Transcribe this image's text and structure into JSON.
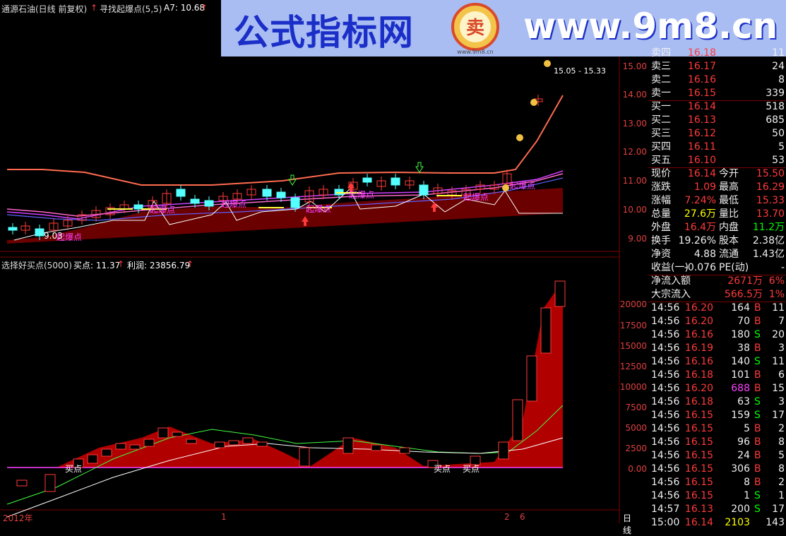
{
  "header": {
    "stock": "通源石油(日线 前复权)",
    "indicator_name": "寻找起爆点(5,5)",
    "a7_label": "A7: 10.68",
    "sub_indicator": "选择好买点(5000)",
    "buy_label": "买点: 11.37",
    "profit_label": "利润: 23856.79"
  },
  "watermark": {
    "cn": "公式指标网",
    "en": "www.9m8.cn",
    "logo_text": "卖",
    "logo_sub": "www.9m8.cn"
  },
  "price_range_label": "15.05 - 15.33",
  "price_axis": [
    "15.00",
    "14.00",
    "13.00",
    "12.00",
    "11.00",
    "10.00",
    "9.00"
  ],
  "volume_axis": [
    "20000",
    "17500",
    "15000",
    "12500",
    "10000",
    "7500",
    "5000",
    "2500",
    "0.00"
  ],
  "x_axis": {
    "year": "2012年",
    "m1": "1",
    "m2": "2",
    "m3": "6"
  },
  "period_label": "日线",
  "chart_annotations": {
    "bao": "起爆点",
    "bao_small": "起爆点",
    "buy": "买点",
    "low_price": "9.03"
  },
  "quote": {
    "asks": [
      {
        "label": "卖四",
        "price": "16.18",
        "vol": "11"
      },
      {
        "label": "卖三",
        "price": "16.17",
        "vol": "24"
      },
      {
        "label": "卖二",
        "price": "16.16",
        "vol": "8"
      },
      {
        "label": "卖一",
        "price": "16.15",
        "vol": "339"
      }
    ],
    "bids": [
      {
        "label": "买一",
        "price": "16.14",
        "vol": "518"
      },
      {
        "label": "买二",
        "price": "16.13",
        "vol": "685"
      },
      {
        "label": "买三",
        "price": "16.12",
        "vol": "50"
      },
      {
        "label": "买四",
        "price": "16.11",
        "vol": "5"
      },
      {
        "label": "买五",
        "price": "16.10",
        "vol": "53"
      }
    ],
    "stats": [
      {
        "k1": "现价",
        "v1": "16.14",
        "c1": "red",
        "k2": "今开",
        "v2": "15.50",
        "c2": "red"
      },
      {
        "k1": "涨跌",
        "v1": "1.09",
        "c1": "red",
        "k2": "最高",
        "v2": "16.29",
        "c2": "red"
      },
      {
        "k1": "涨幅",
        "v1": "7.24%",
        "c1": "red",
        "k2": "最低",
        "v2": "15.33",
        "c2": "red"
      },
      {
        "k1": "总量",
        "v1": "27.6万",
        "c1": "yel",
        "k2": "量比",
        "v2": "13.70",
        "c2": "red"
      },
      {
        "k1": "外盘",
        "v1": "16.4万",
        "c1": "red",
        "k2": "内盘",
        "v2": "11.2万",
        "c2": "grn"
      },
      {
        "k1": "换手",
        "v1": "19.26%",
        "c1": "wht",
        "k2": "股本",
        "v2": "2.38亿",
        "c2": "wht"
      },
      {
        "k1": "净资",
        "v1": "4.88",
        "c1": "wht",
        "k2": "流通",
        "v2": "1.43亿",
        "c2": "wht"
      },
      {
        "k1": "收益(一)",
        "v1": "-0.076",
        "c1": "wht",
        "k2": "PE(动)",
        "v2": "-",
        "c2": "wht"
      }
    ],
    "net_inflow": {
      "label": "净流入额",
      "value": "2671万",
      "pct": "6%"
    },
    "block_inflow": {
      "label": "大宗流入",
      "value": "566.5万",
      "pct": "1%"
    },
    "ticks": [
      {
        "t": "14:56",
        "p": "16.20",
        "v": "164",
        "s": "B",
        "n": "11"
      },
      {
        "t": "14:56",
        "p": "16.20",
        "v": "70",
        "s": "B",
        "n": "7"
      },
      {
        "t": "14:56",
        "p": "16.16",
        "v": "180",
        "s": "S",
        "n": "20"
      },
      {
        "t": "14:56",
        "p": "16.19",
        "v": "38",
        "s": "B",
        "n": "3"
      },
      {
        "t": "14:56",
        "p": "16.16",
        "v": "140",
        "s": "S",
        "n": "11"
      },
      {
        "t": "14:56",
        "p": "16.18",
        "v": "101",
        "s": "B",
        "n": "6"
      },
      {
        "t": "14:56",
        "p": "16.20",
        "v": "688",
        "s": "B",
        "n": "15"
      },
      {
        "t": "14:56",
        "p": "16.18",
        "v": "63",
        "s": "S",
        "n": "3"
      },
      {
        "t": "14:56",
        "p": "16.15",
        "v": "159",
        "s": "S",
        "n": "17"
      },
      {
        "t": "14:56",
        "p": "16.15",
        "v": "5",
        "s": "B",
        "n": "2"
      },
      {
        "t": "14:56",
        "p": "16.15",
        "v": "96",
        "s": "B",
        "n": "8"
      },
      {
        "t": "14:56",
        "p": "16.15",
        "v": "24",
        "s": "B",
        "n": "5"
      },
      {
        "t": "14:56",
        "p": "16.15",
        "v": "306",
        "s": "B",
        "n": "8"
      },
      {
        "t": "14:56",
        "p": "16.15",
        "v": "8",
        "s": "B",
        "n": "2"
      },
      {
        "t": "14:56",
        "p": "16.15",
        "v": "1",
        "s": "S",
        "n": "1"
      },
      {
        "t": "14:57",
        "p": "16.13",
        "v": "200",
        "s": "S",
        "n": "17"
      },
      {
        "t": "15:00",
        "p": "16.14",
        "v": "2103",
        "s": "",
        "n": "143"
      }
    ]
  },
  "colors": {
    "up": "#ff3a3a",
    "down": "#54ffff",
    "bg": "#000000",
    "fill": "#b00000"
  }
}
